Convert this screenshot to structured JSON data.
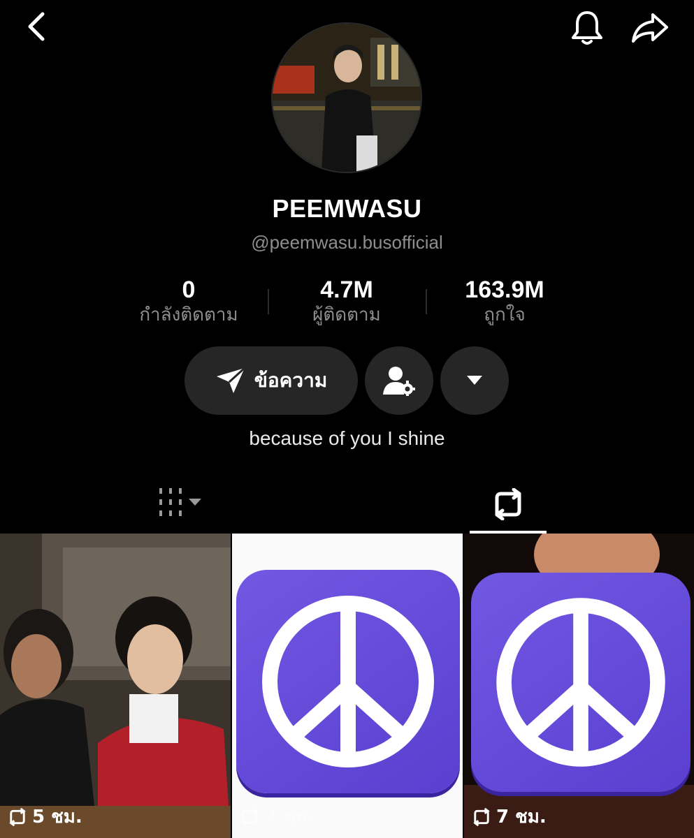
{
  "profile": {
    "display_name": "PEEMWASU",
    "handle": "@peemwasu.busofficial",
    "bio": "because of you I shine"
  },
  "stats": [
    {
      "value": "0",
      "label": "กำลังติดตาม"
    },
    {
      "value": "4.7M",
      "label": "ผู้ติดตาม"
    },
    {
      "value": "163.9M",
      "label": "ถูกใจ"
    }
  ],
  "actions": {
    "message_label": "ข้อความ"
  },
  "icons": {
    "back": "back-chevron-icon",
    "bell": "bell-icon",
    "share": "share-arrow-icon",
    "send": "send-icon",
    "add_friend": "user-gear-icon",
    "more": "caret-down-icon",
    "videos_tab": "grid-icon",
    "reposts_tab": "repost-icon"
  },
  "grid": [
    {
      "time": "5 ชม."
    },
    {
      "time": "7 ชม."
    },
    {
      "time": "7 ชม."
    }
  ],
  "colors": {
    "background": "#000000",
    "secondary_text": "#8e8e8e",
    "pill": "#262626",
    "peace_purple": "#6a4fdc"
  }
}
